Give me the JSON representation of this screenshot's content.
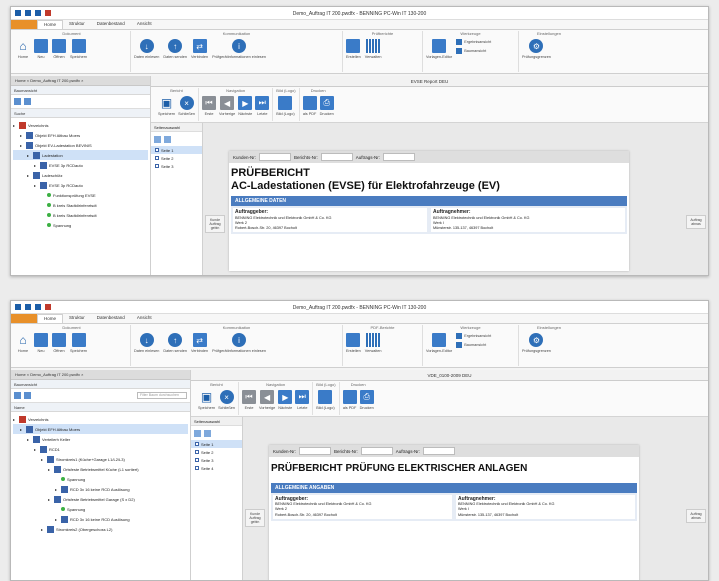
{
  "screens": [
    {
      "window_title": "Demo_Auftrag IT 200.pwdfx - BENNING PC-Win IT 130-200",
      "tabs": [
        "",
        "Home",
        "Struktur",
        "Datenbestand",
        "Ansicht"
      ],
      "ribbon_groups": [
        {
          "title": "Dokument",
          "buttons": [
            "Home",
            "Neu",
            "Öffnen",
            "Speichern"
          ]
        },
        {
          "title": "Kommunikation",
          "buttons": [
            "Daten einlesen",
            "Daten senden",
            "Verbinden",
            "Prüfgerätinformationen einlesen"
          ]
        },
        {
          "title": "Prüfberichte",
          "buttons": [
            "Erstellen",
            "Verwalten"
          ]
        },
        {
          "title": "Werkzeuge",
          "buttons": [
            "Vorlagen-Editor"
          ],
          "small": [
            "Ergebnisansicht",
            "Baumansicht"
          ]
        },
        {
          "title": "Einstellungen",
          "buttons": [
            "Prüfungsgrenzen"
          ]
        }
      ],
      "doc_tab": "Home  ×  Demo_Auftrag IT 200.pwdfx  ×",
      "panel_title": "Baumansicht",
      "filter_placeholder": "",
      "tree_header": "Suche",
      "tree": [
        {
          "label": "Verzeichnis",
          "indent": 0,
          "kind": "root"
        },
        {
          "label": "Objekt EFH Altbau Moers",
          "indent": 1,
          "kind": "sq"
        },
        {
          "label": "Objekt EV-Ladestation BEVINIS",
          "indent": 1,
          "kind": "sq"
        },
        {
          "label": "Ladestation",
          "indent": 2,
          "kind": "sq",
          "selected": true
        },
        {
          "label": "EVSE 3p RCDauto",
          "indent": 3,
          "kind": "sq"
        },
        {
          "label": "Ladeschütz",
          "indent": 2,
          "kind": "sq"
        },
        {
          "label": "EVSE 3p RCDauto",
          "indent": 3,
          "kind": "sq"
        },
        {
          "label": "Funktionsprüfung EVSE",
          "indent": 4,
          "kind": "dot"
        },
        {
          "label": "B kreis Stadtdirinfenrtsdt",
          "indent": 4,
          "kind": "dot"
        },
        {
          "label": "B kreis Stadtdirinfenrtsdt",
          "indent": 4,
          "kind": "dot"
        },
        {
          "label": "Spannung",
          "indent": 4,
          "kind": "dot"
        }
      ],
      "editor_title": "EVSE Report DEU",
      "editor_groups": [
        {
          "title": "Bericht",
          "buttons": [
            "Speichern",
            "Schließen"
          ]
        },
        {
          "title": "Navigation",
          "buttons": [
            "Erste",
            "Vorherige",
            "Nächste",
            "Letzte"
          ]
        },
        {
          "title": "Bild (Logo)",
          "buttons": [
            "Bild (Logo)"
          ]
        },
        {
          "title": "Drucken",
          "buttons": [
            "als PDF",
            "Drucken"
          ]
        }
      ],
      "pages_header": "Seitenauswahl",
      "pages": [
        "Seite 1",
        "Seite 2",
        "Seite 3"
      ],
      "fields": [
        "Kunden-Nr:",
        "Berichts-Nr:",
        "Auftrags-Nr:"
      ],
      "report_title_1": "PRÜFBERICHT",
      "report_title_2": "AC-Ladestationen (EVSE) für Elektrofahrzeuge (EV)",
      "band": "ALLGEMEINE DATEN",
      "client_head": "Auftraggeber:",
      "client_lines": [
        "BENNING Elektrotechnik und Elektronik GmbH & Co. KG",
        "Werk 2",
        "Robert-Bosch-Str. 20, 46397 Bocholt"
      ],
      "contractor_head": "Auftragnehmer:",
      "contractor_lines": [
        "BENNING Elektrotechnik und Elektronik GmbH & Co. KG",
        "Werk I",
        "Münsterstr. 135-137, 46397 Bocholt"
      ],
      "left_side_btn": "Kunde Auftrag gebin",
      "right_side_btn": "Auftrag abnas"
    },
    {
      "window_title": "Demo_Auftrag IT 200.pwdfx - BENNING PC-Win IT 130-200",
      "tabs": [
        "",
        "Home",
        "Struktur",
        "Datenbestand",
        "Ansicht"
      ],
      "ribbon_groups": [
        {
          "title": "Dokument",
          "buttons": [
            "Home",
            "Neu",
            "Öffnen",
            "Speichern"
          ]
        },
        {
          "title": "Kommunikation",
          "buttons": [
            "Daten einlesen",
            "Daten senden",
            "Verbinden",
            "Prüfgerätinformationen einlesen"
          ]
        },
        {
          "title": "PDF-Berichte",
          "buttons": [
            "Erstellen",
            "Verwalten"
          ]
        },
        {
          "title": "Werkzeuge",
          "buttons": [
            "Vorlagen-Editor"
          ],
          "small": [
            "Ergebnisansicht",
            "Baumansicht"
          ]
        },
        {
          "title": "Einstellungen",
          "buttons": [
            "Prüfungsgrenzen"
          ]
        }
      ],
      "doc_tab": "Home  ×  Demo_Auftrag IT 200.pwdfx  ×",
      "panel_title": "Baumansicht",
      "filter_placeholder": "Filter Baum durchsuchen",
      "tree_header": "Name",
      "tree": [
        {
          "label": "Verzeichnis",
          "indent": 0,
          "kind": "root"
        },
        {
          "label": "Objekt EFH Altbau Moers",
          "indent": 1,
          "kind": "sq",
          "selected": true
        },
        {
          "label": "Verteilerh Keller",
          "indent": 2,
          "kind": "sq"
        },
        {
          "label": "RCD1",
          "indent": 3,
          "kind": "sq"
        },
        {
          "label": "Stromkreis1 (Küche+Garage L1/L2/L3)",
          "indent": 4,
          "kind": "sq"
        },
        {
          "label": "Ortsfeste Betriebsmittel Küche (L1 sortiert)",
          "indent": 5,
          "kind": "sq"
        },
        {
          "label": "Spannung",
          "indent": 6,
          "kind": "dot"
        },
        {
          "label": "RCD 3x 16 keine RCD Auslösung",
          "indent": 6,
          "kind": "sq"
        },
        {
          "label": "Ortsfeste Betriebsmittel Garage (S x D2)",
          "indent": 5,
          "kind": "sq"
        },
        {
          "label": "Spannung",
          "indent": 6,
          "kind": "dot"
        },
        {
          "label": "RCD 3x 16 keine RCD Auslösung",
          "indent": 6,
          "kind": "sq"
        },
        {
          "label": "Stromkreis2 (Obergeschoss L2)",
          "indent": 4,
          "kind": "sq"
        }
      ],
      "editor_title": "VDE_0100-2009 DEU",
      "editor_groups": [
        {
          "title": "Bericht",
          "buttons": [
            "Speichern",
            "Schließen"
          ]
        },
        {
          "title": "Navigation",
          "buttons": [
            "Erste",
            "Vorherige",
            "Nächste",
            "Letzte"
          ]
        },
        {
          "title": "Bild (Logo)",
          "buttons": [
            "Bild (Logo)"
          ]
        },
        {
          "title": "Drucken",
          "buttons": [
            "als PDF",
            "Drucken"
          ]
        }
      ],
      "pages_header": "Seitenauswahl",
      "pages": [
        "Seite 1",
        "Seite 2",
        "Seite 3",
        "Seite 4"
      ],
      "fields": [
        "Kunden-Nr:",
        "Berichts-Nr:",
        "Auftrags-Nr:"
      ],
      "report_title_1": "PRÜFBERICHT PRÜFUNG ELEKTRISCHER ANLAGEN",
      "report_title_2": "",
      "band": "ALLGEMEINE ANGABEN",
      "client_head": "Auftraggeber:",
      "client_lines": [
        "BENNING Elektrotechnik und Elektronik GmbH & Co. KG",
        "Werk 2",
        "Robert-Bosch-Str. 20, 46397 Bocholt"
      ],
      "contractor_head": "Auftragnehmer:",
      "contractor_lines": [
        "BENNING Elektrotechnik und Elektronik GmbH & Co. KG",
        "Werk I",
        "Münsterstr. 135-137, 46397 Bocholt"
      ],
      "left_side_btn": "Kunde Auftrag gebin",
      "right_side_btn": "Auftrag abnas"
    }
  ],
  "colors": {
    "brand_blue": "#1c5ea8",
    "file_tab": "#e8902a",
    "band": "#4a7cc0",
    "selection": "#cfe1f7"
  }
}
